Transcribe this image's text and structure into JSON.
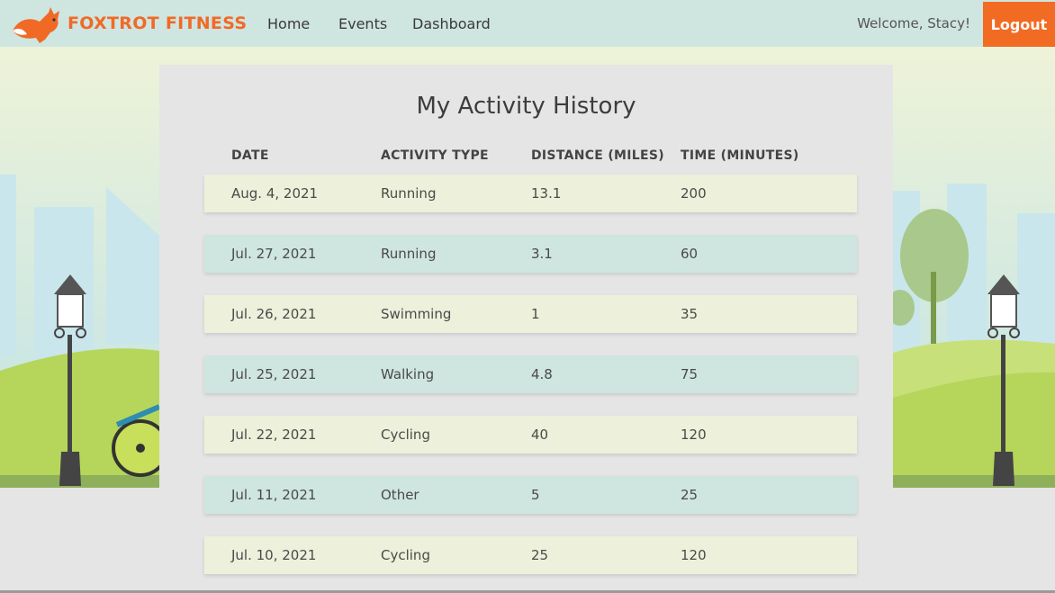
{
  "header": {
    "brand": "FOXTROT FITNESS",
    "nav": [
      "Home",
      "Events",
      "Dashboard"
    ],
    "welcome": "Welcome, Stacy!",
    "logout": "Logout"
  },
  "history": {
    "title": "My Activity History",
    "columns": [
      "DATE",
      "ACTIVITY TYPE",
      "DISTANCE (MILES)",
      "TIME (MINUTES)"
    ],
    "rows": [
      [
        "Aug. 4, 2021",
        "Running",
        "13.1",
        "200"
      ],
      [
        "Jul. 27, 2021",
        "Running",
        "3.1",
        "60"
      ],
      [
        "Jul. 26, 2021",
        "Swimming",
        "1",
        "35"
      ],
      [
        "Jul. 25, 2021",
        "Walking",
        "4.8",
        "75"
      ],
      [
        "Jul. 22, 2021",
        "Cycling",
        "40",
        "120"
      ],
      [
        "Jul. 11, 2021",
        "Other",
        "5",
        "25"
      ],
      [
        "Jul. 10, 2021",
        "Cycling",
        "25",
        "120"
      ]
    ]
  },
  "colors": {
    "brand": "#f06a26",
    "navbar": "#cfe5e0",
    "row_odd": "#edf0da",
    "row_even": "#cfe5df"
  }
}
